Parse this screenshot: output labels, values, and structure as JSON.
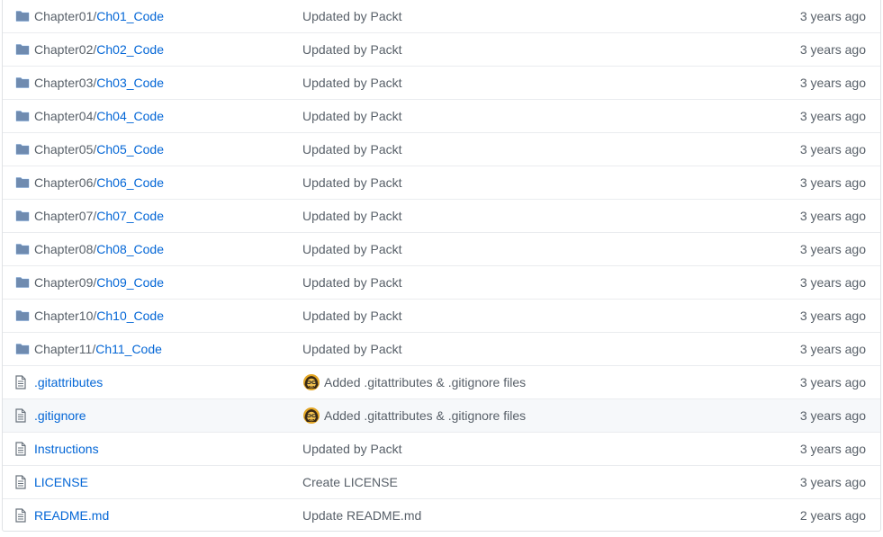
{
  "files": [
    {
      "type": "dir",
      "prefix": "Chapter01/",
      "name": "Ch01_Code",
      "message": "Updated by Packt",
      "avatar": false,
      "age": "3 years ago"
    },
    {
      "type": "dir",
      "prefix": "Chapter02/",
      "name": "Ch02_Code",
      "message": "Updated by Packt",
      "avatar": false,
      "age": "3 years ago"
    },
    {
      "type": "dir",
      "prefix": "Chapter03/",
      "name": "Ch03_Code",
      "message": "Updated by Packt",
      "avatar": false,
      "age": "3 years ago"
    },
    {
      "type": "dir",
      "prefix": "Chapter04/",
      "name": "Ch04_Code",
      "message": "Updated by Packt",
      "avatar": false,
      "age": "3 years ago"
    },
    {
      "type": "dir",
      "prefix": "Chapter05/",
      "name": "Ch05_Code",
      "message": "Updated by Packt",
      "avatar": false,
      "age": "3 years ago"
    },
    {
      "type": "dir",
      "prefix": "Chapter06/",
      "name": "Ch06_Code",
      "message": "Updated by Packt",
      "avatar": false,
      "age": "3 years ago"
    },
    {
      "type": "dir",
      "prefix": "Chapter07/",
      "name": "Ch07_Code",
      "message": "Updated by Packt",
      "avatar": false,
      "age": "3 years ago"
    },
    {
      "type": "dir",
      "prefix": "Chapter08/",
      "name": "Ch08_Code",
      "message": "Updated by Packt",
      "avatar": false,
      "age": "3 years ago"
    },
    {
      "type": "dir",
      "prefix": "Chapter09/",
      "name": "Ch09_Code",
      "message": "Updated by Packt",
      "avatar": false,
      "age": "3 years ago"
    },
    {
      "type": "dir",
      "prefix": "Chapter10/",
      "name": "Ch10_Code",
      "message": "Updated by Packt",
      "avatar": false,
      "age": "3 years ago"
    },
    {
      "type": "dir",
      "prefix": "Chapter11/",
      "name": "Ch11_Code",
      "message": "Updated by Packt",
      "avatar": false,
      "age": "3 years ago"
    },
    {
      "type": "file",
      "prefix": "",
      "name": ".gitattributes",
      "message": "Added .gitattributes & .gitignore files",
      "avatar": true,
      "age": "3 years ago"
    },
    {
      "type": "file",
      "prefix": "",
      "name": ".gitignore",
      "message": "Added .gitattributes & .gitignore files",
      "avatar": true,
      "age": "3 years ago",
      "hover": true
    },
    {
      "type": "file",
      "prefix": "",
      "name": "Instructions",
      "message": "Updated by Packt",
      "avatar": false,
      "age": "3 years ago"
    },
    {
      "type": "file",
      "prefix": "",
      "name": "LICENSE",
      "message": "Create LICENSE",
      "avatar": false,
      "age": "3 years ago"
    },
    {
      "type": "file",
      "prefix": "",
      "name": "README.md",
      "message": "Update README.md",
      "avatar": false,
      "age": "2 years ago"
    }
  ],
  "colors": {
    "link": "#0366d6",
    "muted": "#586069",
    "folder_icon": "#79b8ff",
    "file_icon": "#6a737d",
    "border": "#eaecef"
  },
  "icons": {
    "dir": "folder-icon",
    "file": "file-icon"
  }
}
